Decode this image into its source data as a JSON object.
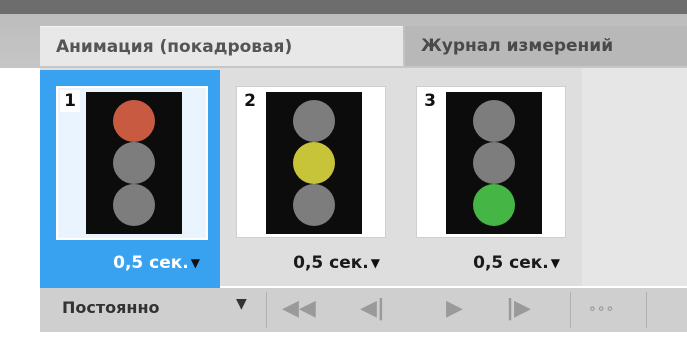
{
  "tabs": [
    {
      "label": "Анимация (покадровая)",
      "active": true
    },
    {
      "label": "Журнал измерений",
      "active": false
    }
  ],
  "frames": [
    {
      "number": "1",
      "delay": "0,5 сек.",
      "selected": true,
      "lit": "red"
    },
    {
      "number": "2",
      "delay": "0,5 сек.",
      "selected": false,
      "lit": "yellow"
    },
    {
      "number": "3",
      "delay": "0,5 сек.",
      "selected": false,
      "lit": "green"
    }
  ],
  "toolbar": {
    "loop_value": "Постоянно",
    "dropdown_glyph": "▼",
    "first_frame_glyph": "◀◀",
    "prev_frame_glyph": "◀|",
    "play_glyph": "▶",
    "next_frame_glyph": "|▶",
    "tween_glyph": "∘∘∘"
  },
  "colors": {
    "selection": "#38a2f0",
    "red_lamp": "#c95a42",
    "yellow_lamp": "#c8c43a",
    "green_lamp": "#45b545",
    "off_lamp": "#7d7d7d"
  }
}
